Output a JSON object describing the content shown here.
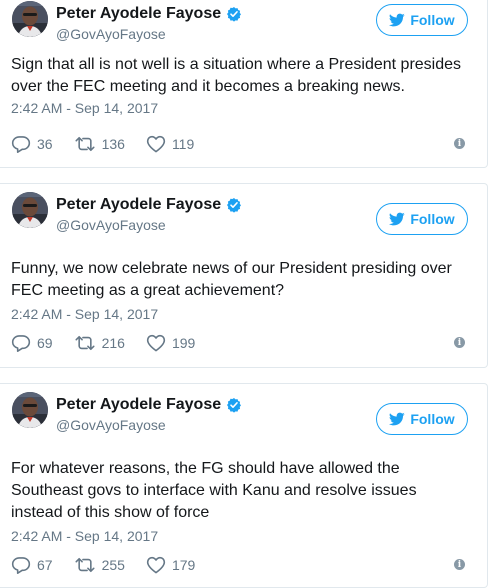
{
  "brand": {
    "blue": "#1da1f2",
    "muted": "#657786",
    "border": "#e1e8ed"
  },
  "tweets": [
    {
      "author_name": "Peter Ayodele Fayose",
      "handle": "@GovAyoFayose",
      "follow_label": "Follow",
      "text": "Sign that all is not well is a situation where a President presides over the FEC meeting and it becomes a breaking news.",
      "timestamp": "2:42 AM - Sep 14, 2017",
      "replies": "36",
      "retweets": "136",
      "likes": "119"
    },
    {
      "author_name": "Peter Ayodele Fayose",
      "handle": "@GovAyoFayose",
      "follow_label": "Follow",
      "text": "Funny, we now celebrate news of our President presiding over FEC meeting as a great achievement?",
      "timestamp": "2:42 AM - Sep 14, 2017",
      "replies": "69",
      "retweets": "216",
      "likes": "199"
    },
    {
      "author_name": "Peter Ayodele Fayose",
      "handle": "@GovAyoFayose",
      "follow_label": "Follow",
      "text": "For whatever reasons, the FG should have allowed the Southeast govs to interface with Kanu and resolve issues instead of this show of force",
      "timestamp": "2:42 AM - Sep 14, 2017",
      "replies": "67",
      "retweets": "255",
      "likes": "179"
    }
  ],
  "icons": {
    "verified": "verified-badge-icon",
    "bird": "twitter-bird-icon",
    "reply": "reply-icon",
    "retweet": "retweet-icon",
    "like": "heart-icon",
    "info": "info-icon"
  }
}
